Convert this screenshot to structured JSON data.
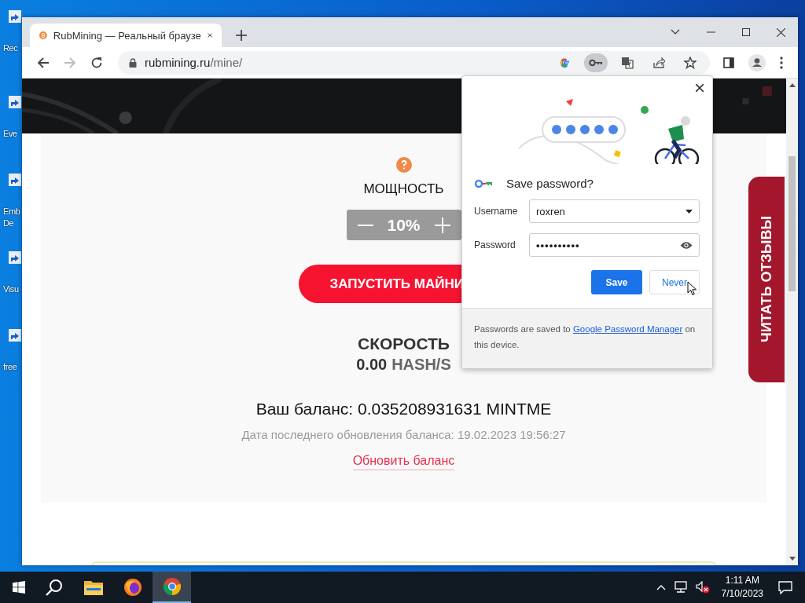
{
  "desktop_icons": [
    {
      "label": "Rec"
    },
    {
      "label": "Eve"
    },
    {
      "label": "Emb De"
    },
    {
      "label": "Visu"
    },
    {
      "label": "free"
    }
  ],
  "browser": {
    "tab_title": "RubMining — Реальный браузе",
    "nav_buttons": [
      {
        "kind": "back",
        "disabled": false
      },
      {
        "kind": "forward",
        "disabled": true
      },
      {
        "kind": "reload",
        "disabled": false
      }
    ],
    "address": {
      "host": "rubmining.ru",
      "path": "/mine/"
    },
    "address_icons": [
      {
        "kind": "google",
        "selected": false
      },
      {
        "kind": "key",
        "selected": true
      },
      {
        "kind": "translate",
        "selected": false
      },
      {
        "kind": "share",
        "selected": false
      },
      {
        "kind": "star",
        "selected": false
      }
    ]
  },
  "page": {
    "power": {
      "label": "МОЩНОСТЬ",
      "value": "10%"
    },
    "start_button": "ЗАПУСТИТЬ МАЙНИ",
    "speed": {
      "label": "СКОРОСТЬ",
      "value": "0.00",
      "unit": "HASH/S"
    },
    "balance": "Ваш баланс: 0.035208931631 MINTME",
    "updated": "Дата последнего обновления баланса: 19.02.2023 19:56:27",
    "refresh_link": "Обновить баланс",
    "reviews_tab": "ЧИТАТЬ ОТЗЫВЫ"
  },
  "popup": {
    "title": "Save password?",
    "fields": [
      {
        "label": "Username",
        "value": "roxren",
        "kind": "dropdown"
      },
      {
        "label": "Password",
        "value": "••••••••••",
        "kind": "password"
      }
    ],
    "buttons": [
      {
        "label": "Save",
        "kind": "primary"
      },
      {
        "label": "Never",
        "kind": "secondary"
      }
    ],
    "note": {
      "before": "Passwords are saved to ",
      "link": "Google Password Manager",
      "after": " on this device."
    }
  },
  "taskbar": {
    "apps": [
      {
        "kind": "explorer",
        "selected": false
      },
      {
        "kind": "firefox",
        "selected": false
      },
      {
        "kind": "chrome",
        "selected": true
      }
    ],
    "time": "1:11 AM",
    "date": "7/10/2023"
  }
}
